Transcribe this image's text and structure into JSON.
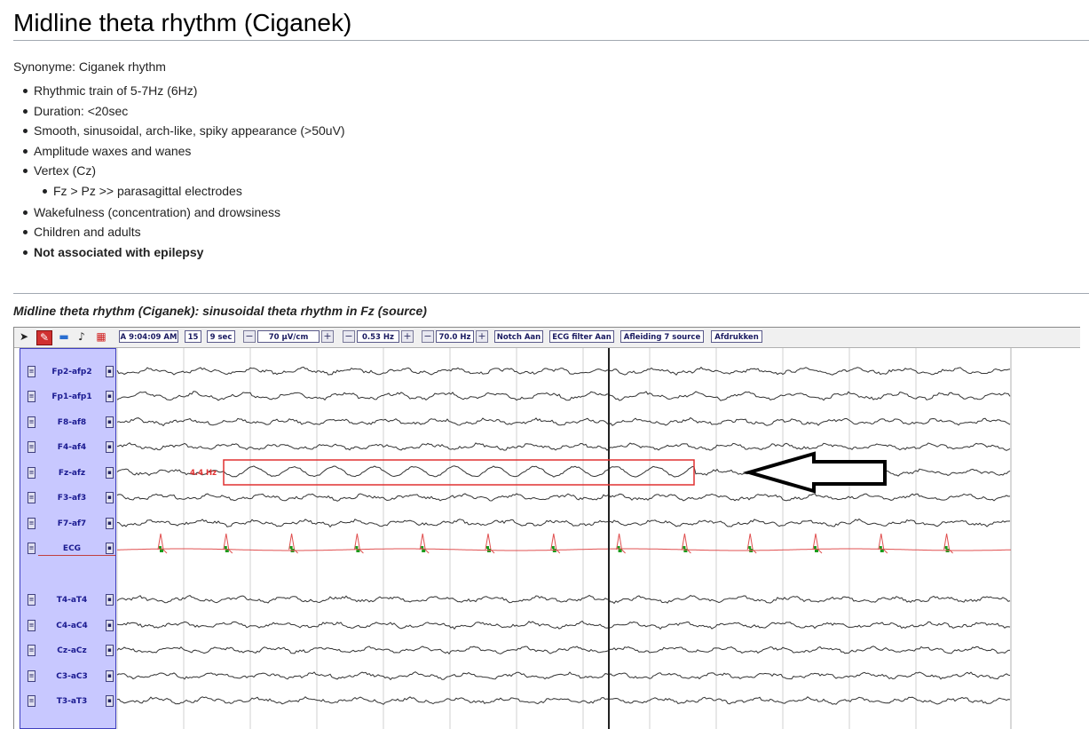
{
  "article": {
    "title": "Midline theta rhythm (Ciganek)",
    "synonym": "Synonyme: Ciganek rhythm",
    "bullets": [
      "Rhythmic train of 5-7Hz (6Hz)",
      "Duration: <20sec",
      "Smooth, sinusoidal, arch-like, spiky appearance (>50uV)",
      "Amplitude waxes and wanes",
      "Vertex (Cz)",
      "Fz > Pz >> parasagittal electrodes",
      "Wakefulness (concentration) and drowsiness",
      "Children and adults",
      "Not associated with epilepsy"
    ],
    "caption": "Midline theta rhythm (Ciganek): sinusoidal theta rhythm in Fz (source)"
  },
  "viewer": {
    "toolbar": {
      "time": "A 9:04:09 AM",
      "page": "15",
      "window": "9 sec",
      "sensitivity": "70 µV/cm",
      "low_filter": "0.53 Hz",
      "high_filter": "70.0 Hz",
      "notch": "Notch Aan",
      "ecg_filter": "ECG filter Aan",
      "montage": "Afleiding 7 source",
      "print": "Afdrukken",
      "minus": "−",
      "plus": "+"
    },
    "icons": [
      "pointer-icon",
      "annotate-icon",
      "folder-icon",
      "speaker-icon",
      "grid-icon"
    ],
    "channels": [
      "Fp2-afp2",
      "Fp1-afp1",
      "F8-af8",
      "F4-af4",
      "Fz-afz",
      "F3-af3",
      "F7-af7",
      "ECG",
      "T4-aT4",
      "C4-aC4",
      "Cz-aCz",
      "C3-aC3",
      "T3-aT3"
    ],
    "annotation": {
      "frequency_label": "4.4 Hz"
    },
    "colors": {
      "trace": "#333333",
      "ecg": "#e05050",
      "ecg_marker": "#1a9a1a",
      "highlight": "#e03030",
      "panel": "#c8c8ff",
      "cursor": "#222222"
    }
  }
}
